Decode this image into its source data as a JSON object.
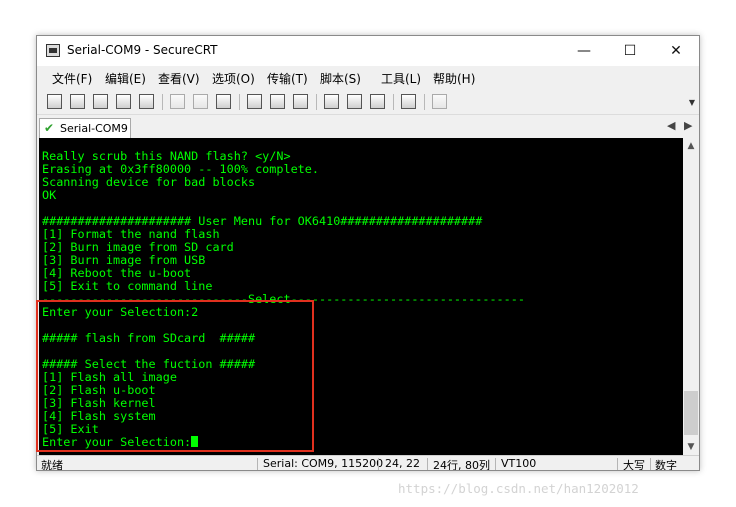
{
  "window": {
    "title": "Serial-COM9 - SecureCRT",
    "controls": {
      "minimize": "—",
      "maximize": "☐",
      "close": "✕"
    }
  },
  "menu": [
    "文件(F)",
    "编辑(E)",
    "查看(V)",
    "选项(O)",
    "传输(T)",
    "脚本(S)",
    "工具(L)",
    "帮助(H)"
  ],
  "toolbar": {
    "icons": [
      "connect-icon",
      "quick-connect-icon",
      "connect-in-tab-icon",
      "reconnect-icon",
      "disconnect-icon",
      "copy-icon",
      "paste-icon",
      "find-icon",
      "print-icon",
      "print-selection-icon",
      "print-screen-icon",
      "session-options-icon",
      "global-options-icon",
      "keymap-icon",
      "help-icon",
      "about-icon"
    ],
    "overflow": "▼"
  },
  "tabs": [
    {
      "label": "Serial-COM9",
      "status_icon": "✔"
    }
  ],
  "tab_nav": {
    "prev": "◀",
    "next": "▶"
  },
  "terminal": {
    "text_color": "#00ff00",
    "lines": [
      "Really scrub this NAND flash? <y/N>",
      "Erasing at 0x3ff80000 -- 100% complete.",
      "Scanning device for bad blocks",
      "OK",
      "",
      "##################### User Menu for OK6410####################",
      "[1] Format the nand flash",
      "[2] Burn image from SD card",
      "[3] Burn image from USB",
      "[4] Reboot the u-boot",
      "[5] Exit to command line",
      "-----------------------------Select---------------------------------",
      "Enter your Selection:2",
      "",
      "##### flash from SDcard  #####",
      "",
      "##### Select the fuction #####",
      "[1] Flash all image",
      "[2] Flash u-boot",
      "[3] Flash kernel",
      "[4] Flash system",
      "[5] Exit",
      "Enter your Selection:"
    ]
  },
  "scrollbar": {
    "up": "▲",
    "down": "▼"
  },
  "status": {
    "ready": "就绪",
    "connection": "Serial: COM9, 115200",
    "cursor_pos": "24,  22",
    "size": "24行, 80列",
    "terminal_type": "VT100",
    "caps": "大写",
    "num": "数字"
  },
  "annotation": {
    "color": "#e0301e"
  },
  "watermark": "https://blog.csdn.net/han1202012"
}
